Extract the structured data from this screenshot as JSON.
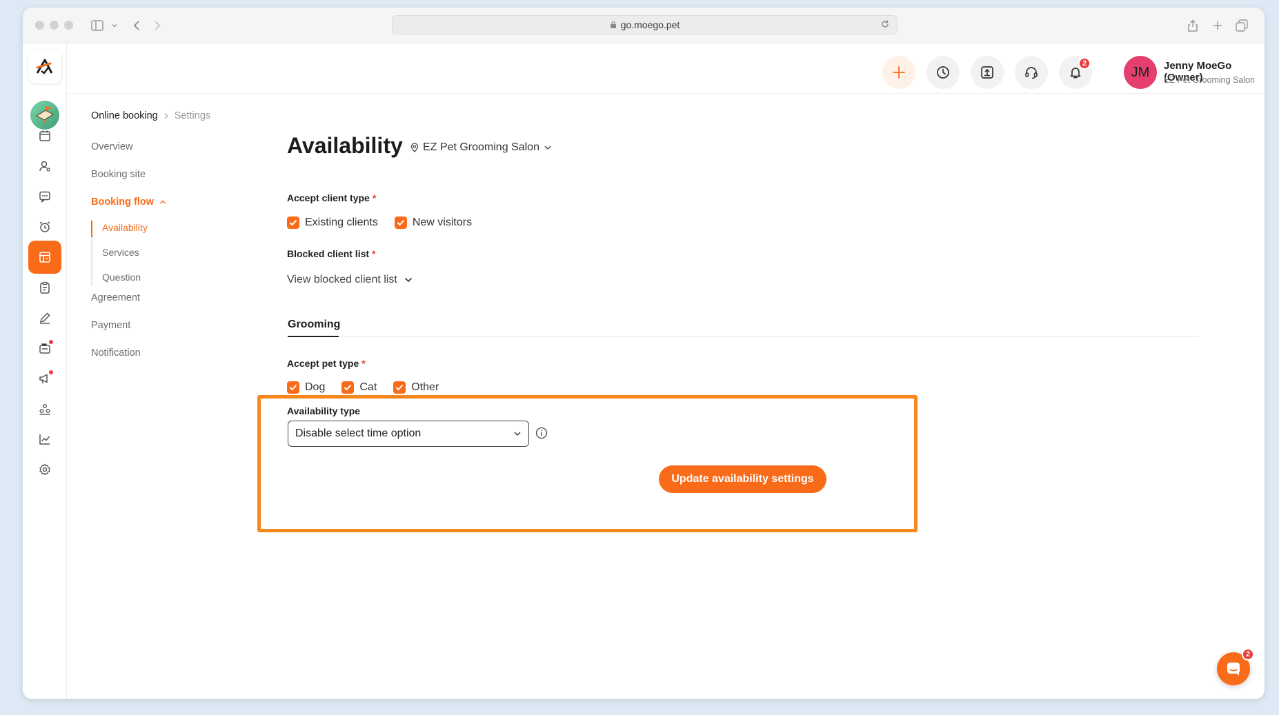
{
  "browser": {
    "url": "go.moego.pet"
  },
  "header": {
    "notifications_count": "2",
    "user": {
      "initials": "JM",
      "name": "Jenny MoeGo (Owner)",
      "business": "EZ Pet Grooming Salon"
    }
  },
  "breadcrumb": {
    "root": "Online booking",
    "current": "Settings"
  },
  "nav": {
    "overview": "Overview",
    "booking_site": "Booking site",
    "booking_flow": "Booking flow",
    "sub": {
      "availability": "Availability",
      "services": "Services",
      "question": "Question"
    },
    "agreement": "Agreement",
    "payment": "Payment",
    "notification": "Notification"
  },
  "main": {
    "title": "Availability",
    "location": "EZ Pet Grooming Salon",
    "accept_client_type": {
      "label": "Accept client type",
      "required": "*",
      "options": {
        "existing": "Existing clients",
        "new": "New visitors"
      }
    },
    "blocked_client_list": {
      "label": "Blocked client list",
      "required": "*",
      "link": "View blocked client list"
    },
    "tabs": {
      "grooming": "Grooming"
    },
    "accept_pet_type": {
      "label": "Accept pet type",
      "required": "*",
      "options": {
        "dog": "Dog",
        "cat": "Cat",
        "other": "Other"
      }
    },
    "availability_type": {
      "label": "Availability type",
      "value": "Disable select time option"
    },
    "update_button": "Update availability settings"
  },
  "chat": {
    "badge": "2"
  },
  "colors": {
    "accent": "#f96b18",
    "highlight": "#f7861c",
    "badge": "#ea3c3c",
    "avatar": "#e43f6f"
  }
}
